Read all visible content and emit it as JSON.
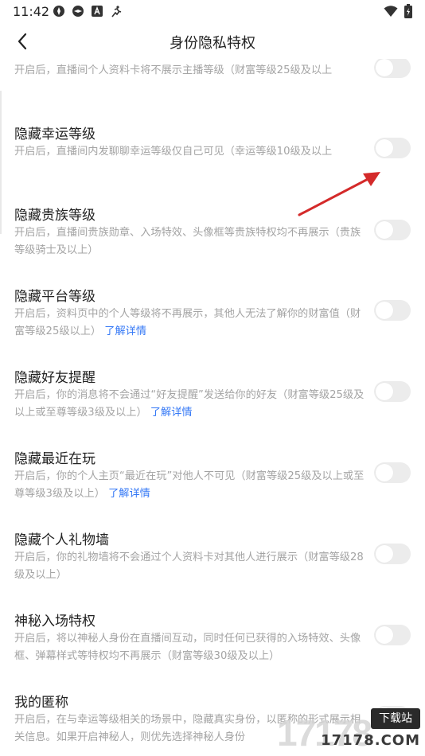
{
  "status_bar": {
    "time": "11:42"
  },
  "nav": {
    "title": "身份隐私特权"
  },
  "items": [
    {
      "title": "",
      "desc": "开启后，直播间个人资料卡将不展示主播等级（财富等级25级及以上",
      "link": ""
    },
    {
      "title": "隐藏幸运等级",
      "desc": "开启后，直播间内发聊聊幸运等级仅自己可见（幸运等级10级及以上",
      "link": ""
    },
    {
      "title": "隐藏贵族等级",
      "desc": "开启后，直播间贵族勋章、入场特效、头像框等贵族特权均不再展示（贵族等级骑士及以上）",
      "link": ""
    },
    {
      "title": "隐藏平台等级",
      "desc": "开启后，资料页中的个人等级将不再展示，其他人无法了解你的财富值（财富等级25级以上）",
      "link": "了解详情"
    },
    {
      "title": "隐藏好友提醒",
      "desc": "开启后，你的消息将不会通过“好友提醒”发送给你的好友（财富等级25级及以上或至尊等级3级及以上）",
      "link": "了解详情"
    },
    {
      "title": "隐藏最近在玩",
      "desc": "开启后，你的个人主页“最近在玩”对他人不可见（财富等级25级及以上或至尊等级3级及以上）",
      "link": "了解详情"
    },
    {
      "title": "隐藏个人礼物墙",
      "desc": "开启后，你的礼物墙将不会通过个人资料卡对其他人进行展示（财富等级28级及以上）",
      "link": ""
    },
    {
      "title": "神秘入场特权",
      "desc": "开启后，将以神秘人身份在直播间互动，同时任何已获得的入场特效、头像框、弹幕样式等特权均不再展示（财富等级30级及以上）",
      "link": ""
    },
    {
      "title": "我的匿称",
      "desc": "开启后，在与幸运等级相关的场景中，隐藏真实身份，以匿称的形式展示相关信息。如果开启神秘人，则优先选择神秘人身份",
      "link": ""
    }
  ],
  "watermark": {
    "digits": "17178",
    "badge": "下载站",
    "site": "17178.COM"
  },
  "colors": {
    "link": "#3478f6",
    "desc": "#a4a4a4",
    "toggle_off": "#ececec",
    "arrow": "#d42a2a"
  }
}
